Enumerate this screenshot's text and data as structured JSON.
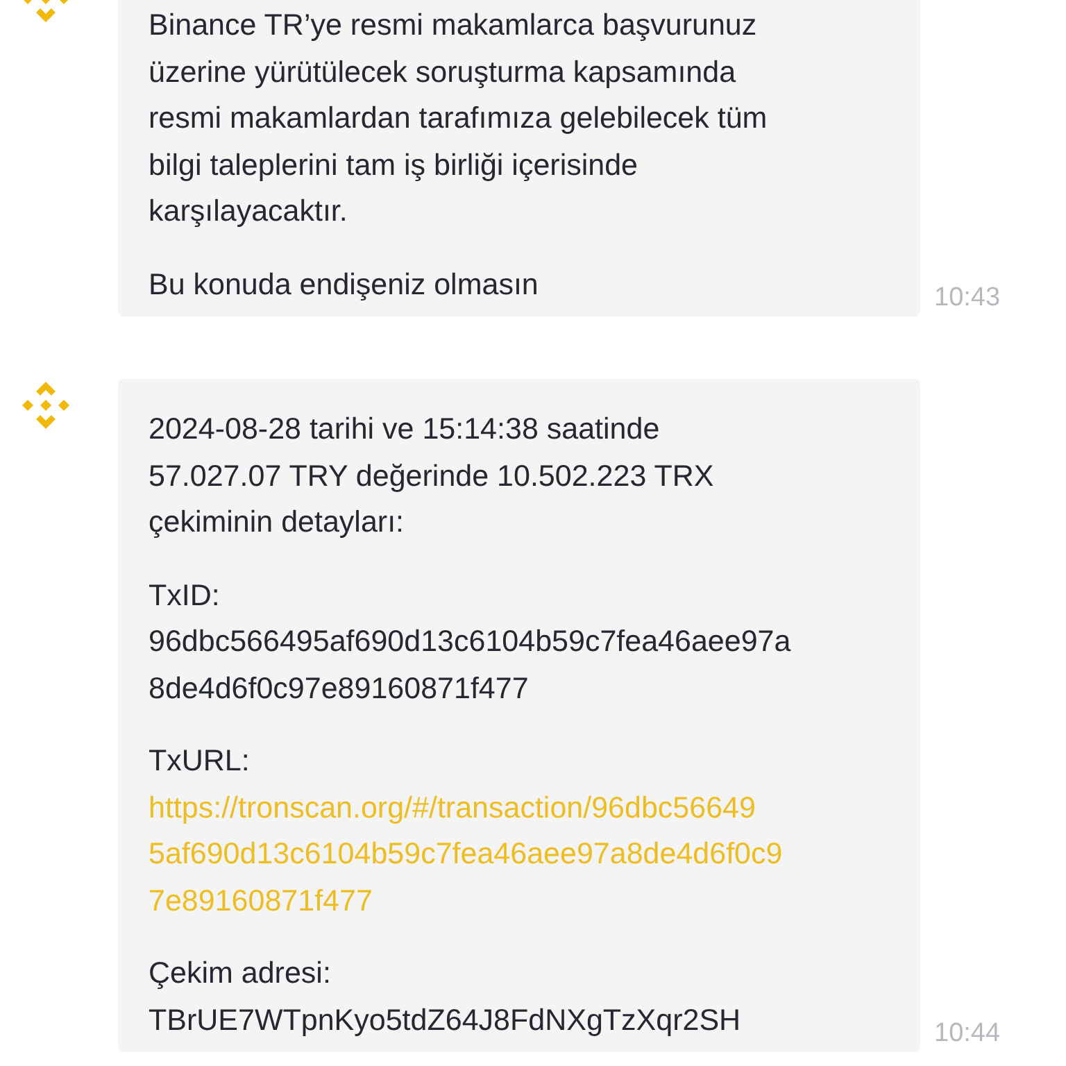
{
  "messages": [
    {
      "time": "10:43",
      "paragraphs": [
        {
          "kind": "text",
          "lines": [
            "Binance TR’ye resmi makamlarca başvurunuz",
            "üzerine yürütülecek soruşturma kapsamında",
            "resmi makamlardan tarafımıza gelebilecek tüm",
            "bilgi taleplerini tam iş birliği içerisinde",
            "karşılayacaktır."
          ]
        },
        {
          "kind": "text",
          "lines": [
            "Bu konuda endişeniz olmasın"
          ]
        }
      ]
    },
    {
      "time": "10:44",
      "paragraphs": [
        {
          "kind": "text",
          "lines": [
            "2024-08-28 tarihi ve 15:14:38 saatinde",
            "57.027.07 TRY değerinde 10.502.223 TRX",
            "çekiminin detayları:"
          ]
        },
        {
          "kind": "text",
          "label": "TxID:",
          "lines": [
            "96dbc566495af690d13c6104b59c7fea46aee97a",
            "8de4d6f0c97e89160871f477"
          ]
        },
        {
          "kind": "link",
          "label": "TxURL:",
          "lines": [
            "https://tronscan.org/#/transaction/96dbc56649",
            "5af690d13c6104b59c7fea46aee97a8de4d6f0c9",
            "7e89160871f477"
          ]
        },
        {
          "kind": "text",
          "label": "Çekim adresi:",
          "lines": [
            "TBrUE7WTpnKyo5tdZ64J8FdNXgTzXqr2SH"
          ]
        }
      ]
    }
  ]
}
